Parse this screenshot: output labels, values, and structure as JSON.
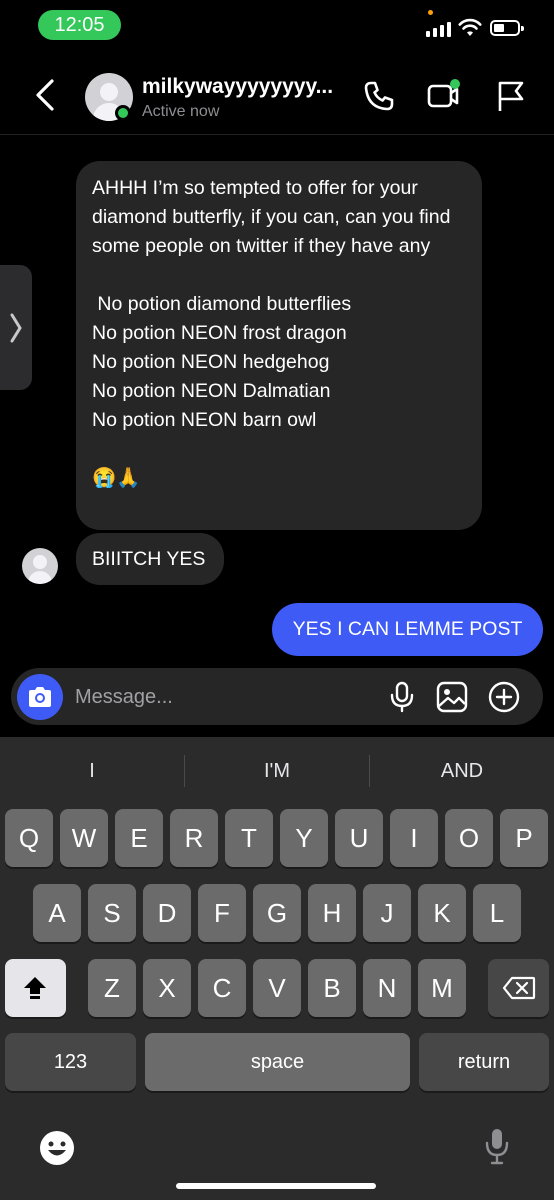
{
  "status_bar": {
    "time": "12:05"
  },
  "header": {
    "username": "milkywayyyyyyyy...",
    "activity": "Active now"
  },
  "messages": {
    "incoming_1": "AHHH I’m so tempted to offer for your diamond butterfly, if you can, can you find some people on twitter if they have any\n\n No potion diamond butterflies\nNo potion NEON frost dragon\nNo potion NEON hedgehog\nNo potion NEON Dalmatian\nNo potion NEON barn owl\n\n😭🙏",
    "incoming_2": "BIIITCH YES",
    "outgoing_1": "YES I CAN LEMME POST"
  },
  "composer": {
    "placeholder": "Message..."
  },
  "keyboard": {
    "suggestions": [
      "I",
      "I'M",
      "AND"
    ],
    "row1": [
      "Q",
      "W",
      "E",
      "R",
      "T",
      "Y",
      "U",
      "I",
      "O",
      "P"
    ],
    "row2": [
      "A",
      "S",
      "D",
      "F",
      "G",
      "H",
      "J",
      "K",
      "L"
    ],
    "row3": [
      "Z",
      "X",
      "C",
      "V",
      "B",
      "N",
      "M"
    ],
    "numbers_label": "123",
    "space_label": "space",
    "return_label": "return"
  },
  "colors": {
    "accent_blue": "#3f5bf5",
    "active_green": "#34c759",
    "bubble_gray": "#262626"
  }
}
